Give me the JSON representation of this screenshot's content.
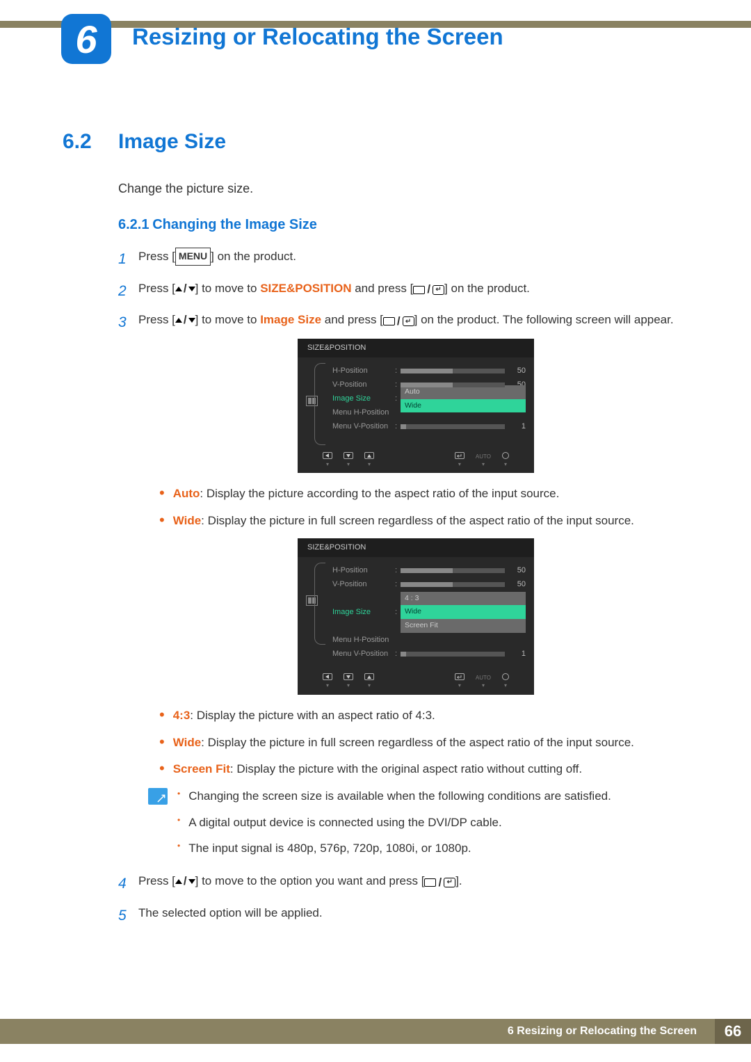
{
  "chapter": {
    "number": "6",
    "title": "Resizing or Relocating the Screen"
  },
  "section": {
    "number": "6.2",
    "title": "Image Size",
    "intro": "Change the picture size."
  },
  "subsection": {
    "number": "6.2.1",
    "title": "Changing the Image Size"
  },
  "steps": {
    "s1": {
      "num": "1",
      "pre": "Press [",
      "menu": "MENU",
      "post": "] on the product."
    },
    "s2": {
      "num": "2",
      "a": "Press [",
      "b": "] to move to ",
      "target": "SIZE&POSITION",
      "c": " and press [",
      "d": "] on the product."
    },
    "s3": {
      "num": "3",
      "a": "Press [",
      "b": "] to move to ",
      "target": "Image Size",
      "c": " and press [",
      "d": "] on the product. The following screen will appear."
    },
    "s4": {
      "num": "4",
      "a": "Press [",
      "b": "] to move to the option you want and press [",
      "c": "]."
    },
    "s5": {
      "num": "5",
      "text": "The selected option will be applied."
    }
  },
  "osd1": {
    "title": "SIZE&POSITION",
    "rows": {
      "hpos": {
        "label": "H-Position",
        "val": "50",
        "fill": 50
      },
      "vpos": {
        "label": "V-Position",
        "val": "50",
        "fill": 50
      },
      "imgsize": {
        "label": "Image Size",
        "options": [
          "Auto",
          "Wide"
        ],
        "sel": 1
      },
      "mhpos": {
        "label": "Menu H-Position"
      },
      "mvpos": {
        "label": "Menu V-Position",
        "val": "1",
        "fill": 5
      }
    },
    "auto": "AUTO"
  },
  "osd2": {
    "title": "SIZE&POSITION",
    "rows": {
      "hpos": {
        "label": "H-Position",
        "val": "50",
        "fill": 50
      },
      "vpos": {
        "label": "V-Position",
        "val": "50",
        "fill": 50
      },
      "imgsize": {
        "label": "Image Size",
        "options": [
          "4 : 3",
          "Wide",
          "Screen Fit"
        ],
        "sel": 1
      },
      "mhpos": {
        "label": "Menu H-Position"
      },
      "mvpos": {
        "label": "Menu V-Position",
        "val": "1",
        "fill": 5
      }
    },
    "auto": "AUTO"
  },
  "bullets1": {
    "auto": {
      "name": "Auto",
      "text": ": Display the picture according to the aspect ratio of the input source."
    },
    "wide": {
      "name": "Wide",
      "text": ": Display the picture in full screen regardless of the aspect ratio of the input source."
    }
  },
  "bullets2": {
    "r43": {
      "name": "4:3",
      "text": ": Display the picture with an aspect ratio of 4:3."
    },
    "wide": {
      "name": "Wide",
      "text": ": Display the picture in full screen regardless of the aspect ratio of the input source."
    },
    "fit": {
      "name": "Screen Fit",
      "text": ": Display the picture with the original aspect ratio without cutting off."
    }
  },
  "note": {
    "n1": "Changing the screen size is available when the following conditions are satisfied.",
    "n2": "A digital output device is connected using the DVI/DP cable.",
    "n3": "The input signal is 480p, 576p, 720p, 1080i, or 1080p."
  },
  "footer": {
    "text": "6 Resizing or Relocating the Screen",
    "page": "66"
  }
}
